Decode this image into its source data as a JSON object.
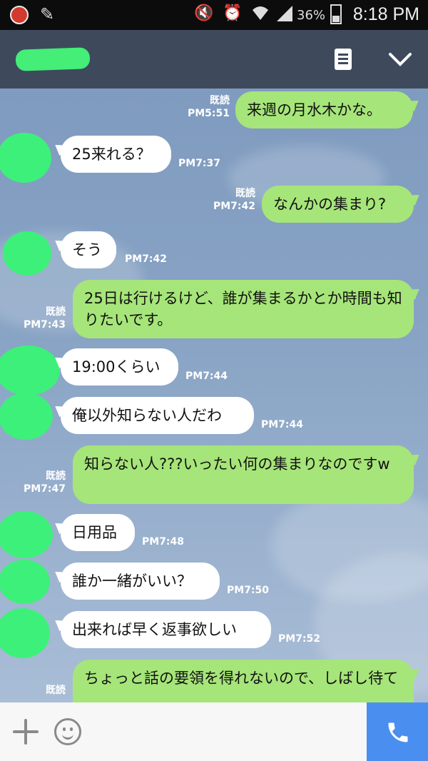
{
  "status_bar": {
    "battery": "36%",
    "time": "8:18 PM"
  },
  "header": {
    "contact_name": "",
    "colors": {
      "header_bg": "#3e4a5c"
    }
  },
  "messages": [
    {
      "side": "out",
      "text": "来週の月水木かな。",
      "read": "既読",
      "time": "PM5:51"
    },
    {
      "side": "in",
      "text": "25来れる？",
      "time": "PM7:37"
    },
    {
      "side": "out",
      "text": "なんかの集まり?",
      "read": "既読",
      "time": "PM7:42"
    },
    {
      "side": "in",
      "text": "そう",
      "time": "PM7:42"
    },
    {
      "side": "out",
      "text": "25日は行けるけど、誰が集まるかとか時間も知りたいです。",
      "read": "既読",
      "time": "PM7:43"
    },
    {
      "side": "in",
      "text": "19:00くらい",
      "time": "PM7:44"
    },
    {
      "side": "in",
      "text": "俺以外知らない人だわ",
      "time": "PM7:44"
    },
    {
      "side": "out",
      "text": "知らない人???いったい何の集まりなのですw",
      "read": "既読",
      "time": "PM7:47"
    },
    {
      "side": "in",
      "text": "日用品",
      "time": "PM7:48"
    },
    {
      "side": "in",
      "text": "誰か一緒がいい？",
      "time": "PM7:50"
    },
    {
      "side": "in",
      "text": "出来れば早く返事欲しい",
      "time": "PM7:52"
    },
    {
      "side": "out",
      "text": "ちょっと話の要領を得れないので、しばし待て",
      "read": "既読",
      "time": ""
    }
  ],
  "icons": {
    "add": "plus-icon",
    "emoji": "smiley-icon",
    "call": "phone-icon",
    "menu": "notes-icon",
    "collapse": "chevron-down-icon"
  },
  "colors": {
    "outgoing_bubble": "#a6e579",
    "incoming_bubble": "#ffffff",
    "avatar_mask": "#3df07a",
    "call_button": "#4a8ff0"
  }
}
